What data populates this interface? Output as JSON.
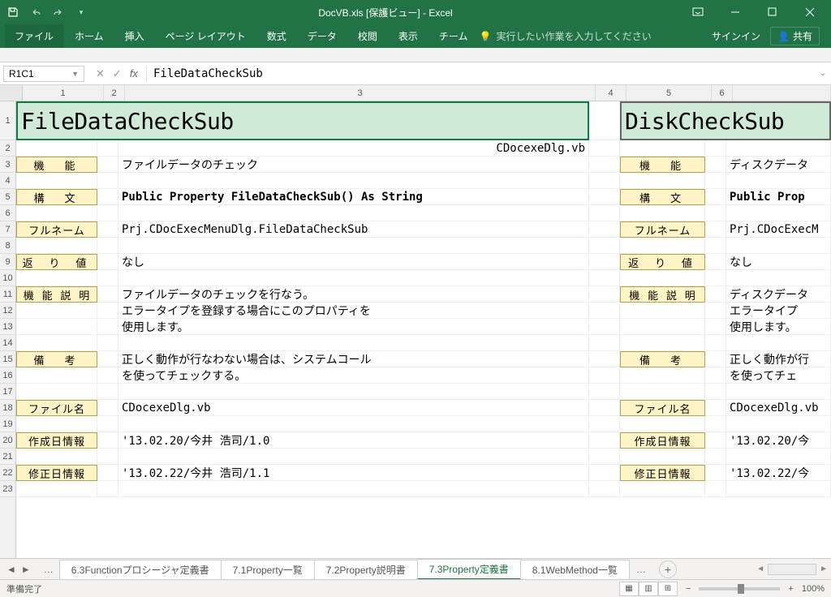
{
  "window": {
    "title": "DocVB.xls [保護ビュー] - Excel"
  },
  "ribbon": {
    "tabs": [
      "ファイル",
      "ホーム",
      "挿入",
      "ページ レイアウト",
      "数式",
      "データ",
      "校閲",
      "表示",
      "チーム"
    ],
    "tellme": "実行したい作業を入力してください",
    "signin": "サインイン",
    "share": "共有"
  },
  "formula": {
    "name_box": "R1C1",
    "value": "FileDataCheckSub"
  },
  "columns": [
    "1",
    "2",
    "3",
    "4",
    "5",
    "6"
  ],
  "rows_visible": 23,
  "cells": {
    "left": {
      "title": "FileDataCheckSub",
      "file_header": "CDocexeDlg.vb",
      "labels": {
        "func": "機　能",
        "syntax": "構　文",
        "fullname": "フルネーム",
        "return": "返 り 値",
        "desc": "機 能 説 明",
        "note": "備　考",
        "filename": "ファイル名",
        "created": "作成日情報",
        "modified": "修正日情報"
      },
      "values": {
        "func": "ファイルデータのチェック",
        "syntax": "Public Property FileDataCheckSub() As String",
        "fullname": "Prj.CDocExecMenuDlg.FileDataCheckSub",
        "return": "なし",
        "desc1": "ファイルデータのチェックを行なう。",
        "desc2": "エラータイプを登録する場合にこのプロパティを",
        "desc3": "使用します。",
        "note1": "正しく動作が行なわない場合は、システムコール",
        "note2": "を使ってチェックする。",
        "filename": "CDocexeDlg.vb",
        "created": "'13.02.20/今井 浩司/1.0",
        "modified": "'13.02.22/今井 浩司/1.1"
      }
    },
    "right": {
      "title": "DiskCheckSub",
      "values": {
        "func": "ディスクデータ",
        "syntax": "Public Prop",
        "fullname": "Prj.CDocExecM",
        "return": "なし",
        "desc1": "ディスクデータ",
        "desc2": "エラータイプ",
        "desc3": "使用します。",
        "note1": "正しく動作が行",
        "note2": "を使ってチェ",
        "filename": "CDocexeDlg.vb",
        "created": "'13.02.20/今",
        "modified": "'13.02.22/今"
      }
    }
  },
  "sheet_tabs": {
    "tabs": [
      "6.3Functionプロシージャ定義書",
      "7.1Property一覧",
      "7.2Property説明書",
      "7.3Property定義書",
      "8.1WebMethod一覧"
    ],
    "active_index": 3
  },
  "status": {
    "ready": "準備完了",
    "zoom": "100%"
  }
}
